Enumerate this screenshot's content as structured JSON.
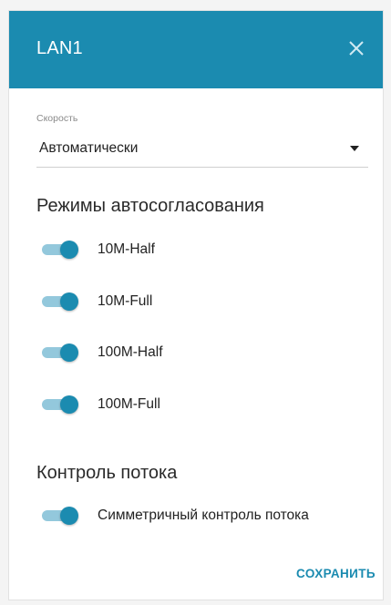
{
  "dialog": {
    "title": "LAN1",
    "close_icon": "close-icon"
  },
  "speed": {
    "label": "Скорость",
    "value": "Автоматически",
    "arrow_icon": "caret-down-icon"
  },
  "autoneg": {
    "title": "Режимы автосогласования",
    "items": [
      {
        "label": "10M-Half",
        "on": true
      },
      {
        "label": "10M-Full",
        "on": true
      },
      {
        "label": "100M-Half",
        "on": true
      },
      {
        "label": "100M-Full",
        "on": true
      }
    ]
  },
  "flow_control": {
    "title": "Контроль потока",
    "items": [
      {
        "label": "Симметричный контроль потока",
        "on": true
      }
    ]
  },
  "actions": {
    "save_label": "СОХРАНИТЬ"
  },
  "colors": {
    "accent": "#1b8bb0",
    "track_on": "#93c8dc"
  }
}
